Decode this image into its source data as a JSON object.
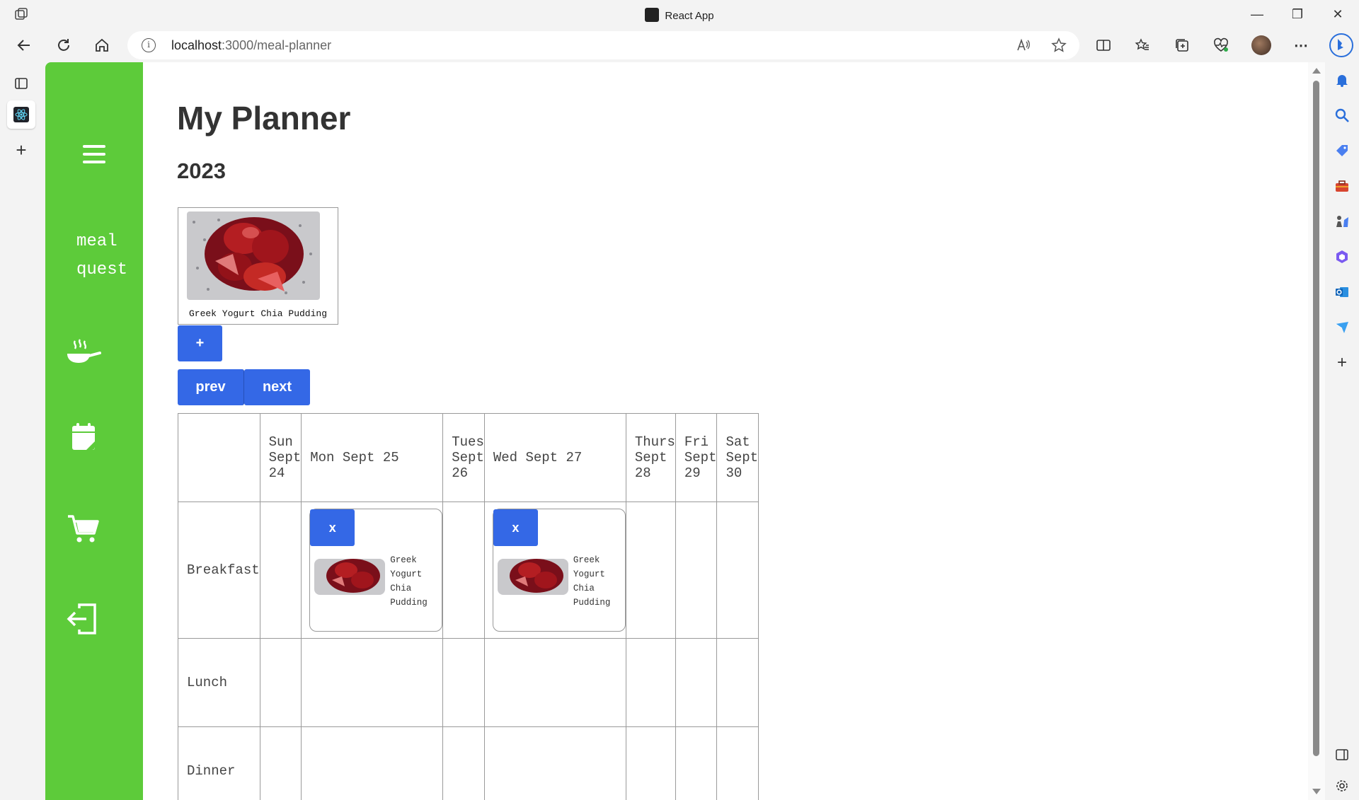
{
  "browser": {
    "window_title": "React App",
    "url_host": "localhost",
    "url_path": ":3000/meal-planner"
  },
  "sidenav": {
    "brand_line1": "meal",
    "brand_line2": "quest",
    "icons": [
      "menu-icon",
      "cooking-pan-icon",
      "calendar-icon",
      "shopping-cart-icon",
      "logout-icon"
    ],
    "color": "#5dcb3a"
  },
  "page": {
    "title": "My Planner",
    "year": "2023",
    "recipe_card": {
      "name": "Greek Yogurt Chia Pudding"
    },
    "add_button": "+",
    "prev_button": "prev",
    "next_button": "next",
    "accent_color": "#3468e6"
  },
  "planner": {
    "days": [
      "Sun Sept 24",
      "Mon Sept 25",
      "Tues Sept 26",
      "Wed Sept 27",
      "Thurs Sept 28",
      "Fri Sept 29",
      "Sat Sept 30"
    ],
    "meals": [
      "Breakfast",
      "Lunch",
      "Dinner"
    ],
    "entries": {
      "mon_breakfast": {
        "remove_label": "x",
        "name_lines": [
          "Greek",
          "Yogurt",
          "Chia",
          "Pudding"
        ]
      },
      "wed_breakfast": {
        "remove_label": "x",
        "name_lines": [
          "Greek",
          "Yogurt",
          "Chia",
          "Pudding"
        ]
      }
    }
  }
}
